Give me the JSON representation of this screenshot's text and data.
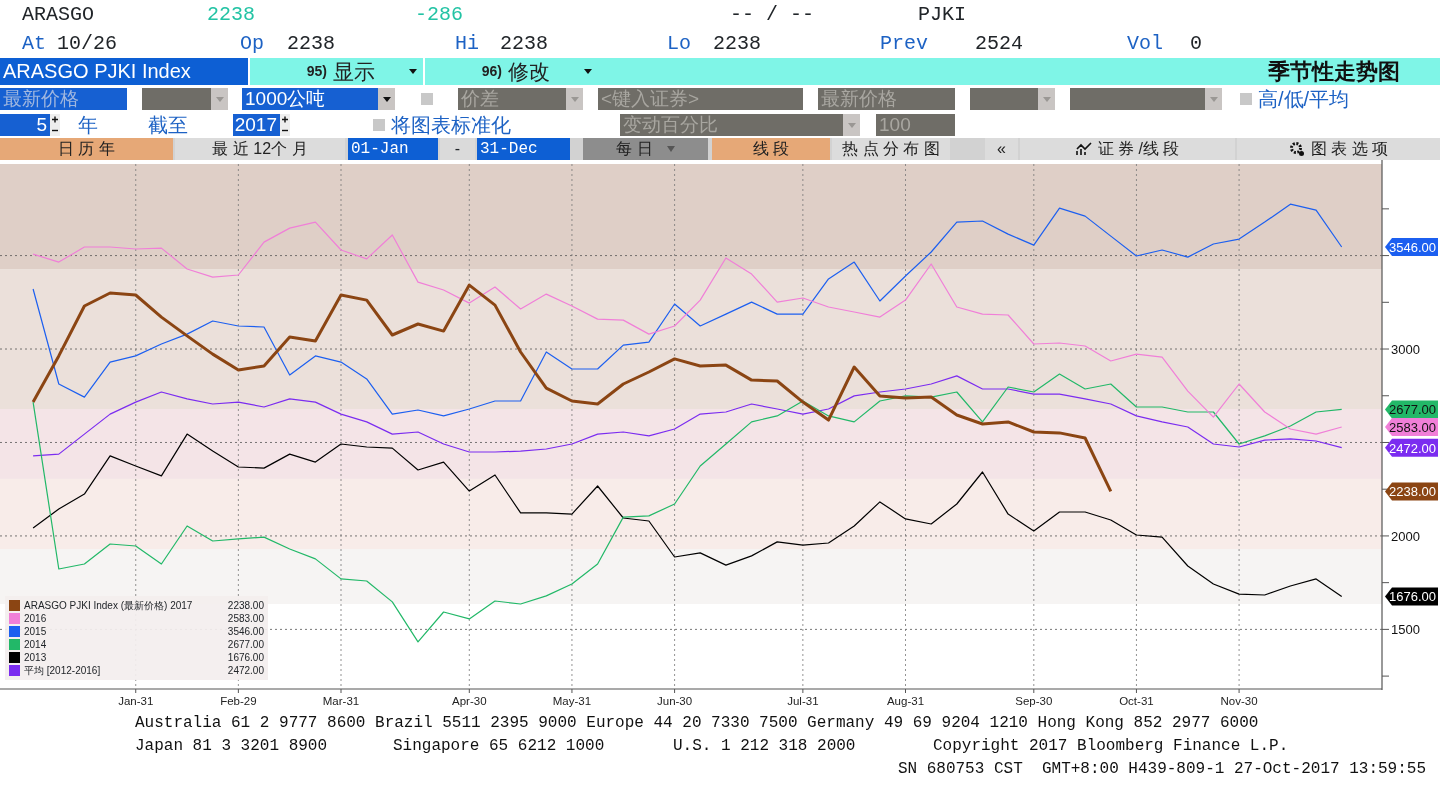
{
  "quote": {
    "ticker": "ARASGO",
    "last": "2238",
    "change": "-286",
    "bid_ask": "-- / --",
    "code": "PJKI"
  },
  "quote_fields": [
    {
      "label": "At",
      "value": "10/26"
    },
    {
      "label": "Op",
      "value": "2238"
    },
    {
      "label": "Hi",
      "value": "2238"
    },
    {
      "label": "Lo",
      "value": "2238"
    },
    {
      "label": "Prev",
      "value": "2524"
    },
    {
      "label": "Vol",
      "value": "0"
    }
  ],
  "title_bar": {
    "security": "ARASGO PJKI Index",
    "menus": [
      {
        "number": "95)",
        "label": "显示"
      },
      {
        "number": "96)",
        "label": "修改"
      }
    ],
    "title": "季节性走势图"
  },
  "settings_row_1": [
    {
      "kind": "field",
      "text": "最新价格",
      "disabled": false
    },
    {
      "kind": "dropdown",
      "disabled": true
    },
    {
      "kind": "dropdown",
      "text": "1000公吨",
      "disabled": false
    },
    {
      "kind": "checkbox",
      "checked": false
    },
    {
      "kind": "dropdown",
      "text": "价差",
      "disabled": true
    },
    {
      "kind": "field",
      "placeholder": "<键入证券>",
      "disabled": true
    },
    {
      "kind": "field",
      "text": "最新价格",
      "disabled": true
    },
    {
      "kind": "dropdown",
      "disabled": true
    },
    {
      "kind": "dropdown",
      "disabled": true
    },
    {
      "kind": "checkbox",
      "checked": false,
      "label": "高/低/平均"
    }
  ],
  "settings_row_2": [
    {
      "kind": "spinner",
      "text": "5"
    },
    {
      "kind": "label",
      "text": "年"
    },
    {
      "kind": "label",
      "text": "截至"
    },
    {
      "kind": "spinner",
      "text": "2017"
    },
    {
      "kind": "checkbox",
      "checked": false,
      "label": "将图表标准化"
    },
    {
      "kind": "dropdown",
      "text": "变动百分比",
      "disabled": true
    },
    {
      "kind": "field",
      "text": "100",
      "disabled": true
    }
  ],
  "toolbar": [
    {
      "kind": "tab",
      "label": "日 历 年",
      "selected": true
    },
    {
      "kind": "tab",
      "label": "最 近 12个 月",
      "selected": false
    },
    {
      "kind": "date",
      "text": "01-Jan"
    },
    {
      "kind": "label",
      "text": "-"
    },
    {
      "kind": "date",
      "text": "31-Dec"
    },
    {
      "kind": "dropdown",
      "text": "每 日",
      "disabled": true
    },
    {
      "kind": "tab",
      "label": "线 段",
      "selected": true
    },
    {
      "kind": "tab",
      "label": "热 点 分 布 图",
      "selected": false
    },
    {
      "kind": "button",
      "label": "«"
    },
    {
      "kind": "series_button",
      "label": "证 券 /线 段"
    },
    {
      "kind": "options_button",
      "label": "图 表 选 项"
    }
  ],
  "chart": {
    "chart_data": {
      "type": "line",
      "categories": [
        null,
        null,
        null,
        null,
        "Jan-31",
        null,
        null,
        null,
        "Feb-29",
        null,
        null,
        null,
        "Mar-31",
        null,
        null,
        null,
        null,
        "Apr-30",
        null,
        null,
        null,
        "May-31",
        null,
        null,
        null,
        "Jun-30",
        null,
        null,
        null,
        null,
        "Jul-31",
        null,
        null,
        null,
        "Aug-31",
        null,
        null,
        null,
        null,
        "Sep-30",
        null,
        null,
        null,
        "Oct-31",
        null,
        null,
        null,
        "Nov-30",
        null,
        null,
        null,
        null
      ],
      "ylim": [
        1181,
        3990
      ],
      "grid": true,
      "legend": "lower left",
      "bands": [
        {
          "axis": "y",
          "from": 3428,
          "to": 3990,
          "color": "#dfcfc7"
        },
        {
          "axis": "y",
          "from": 2679,
          "to": 3428,
          "color": "#ebe0da"
        },
        {
          "axis": "y",
          "from": 2305,
          "to": 2679,
          "color": "#f4e4e7"
        },
        {
          "axis": "y",
          "from": 1930,
          "to": 2305,
          "color": "#f8ece9"
        },
        {
          "axis": "y",
          "from": 1636,
          "to": 1930,
          "color": "#f6f4f3"
        }
      ],
      "yticks": [
        1500,
        2000,
        3000
      ],
      "series": [
        {
          "name": "ARASGO PJKI Index (最新价格) 2017",
          "color": "#8b4513",
          "values": [
            2716,
            2963,
            3230,
            3300,
            3289,
            3171,
            3070,
            2973,
            2888,
            2909,
            3064,
            3043,
            3289,
            3262,
            3075,
            3134,
            3096,
            3342,
            3235,
            2984,
            2791,
            2722,
            2706,
            2813,
            2877,
            2947,
            2909,
            2914,
            2834,
            2829,
            2716,
            2620,
            2904,
            2749,
            2738,
            2743,
            2647,
            2599,
            2610,
            2556,
            2551,
            2524,
            2238,
            null,
            null,
            null,
            null,
            null,
            null,
            null,
            null,
            null
          ]
        },
        {
          "name": "2016",
          "color": "#f07fd8",
          "values": [
            3508,
            3465,
            3546,
            3546,
            3535,
            3540,
            3428,
            3385,
            3396,
            3572,
            3647,
            3679,
            3530,
            3482,
            3610,
            3358,
            3316,
            3246,
            3332,
            3214,
            3294,
            3230,
            3160,
            3155,
            3080,
            3123,
            3262,
            3487,
            3401,
            3251,
            3273,
            3225,
            3198,
            3171,
            3262,
            3455,
            3225,
            3187,
            3182,
            3027,
            3032,
            3016,
            2936,
            2973,
            2957,
            2775,
            2636,
            2813,
            2663,
            2572,
            2545,
            2583
          ]
        },
        {
          "name": "2015",
          "color": "#1c5ff0",
          "values": [
            3321,
            2813,
            2743,
            2930,
            2963,
            3027,
            3080,
            3150,
            3123,
            3118,
            2861,
            2963,
            2930,
            2840,
            2652,
            2674,
            2642,
            2679,
            2722,
            2722,
            2984,
            2893,
            2893,
            3021,
            3037,
            3241,
            3123,
            3187,
            3251,
            3187,
            3187,
            3375,
            3465,
            3257,
            3391,
            3519,
            3679,
            3685,
            3615,
            3556,
            3754,
            3711,
            3604,
            3498,
            3530,
            3492,
            3562,
            3588,
            3679,
            3775,
            3743,
            3546
          ]
        },
        {
          "name": "2014",
          "color": "#22b868",
          "values": [
            2716,
            1823,
            1850,
            1957,
            1946,
            1850,
            2053,
            1973,
            1984,
            1994,
            1930,
            1877,
            1770,
            1759,
            1647,
            1433,
            1593,
            1556,
            1652,
            1636,
            1679,
            1743,
            1850,
            2101,
            2107,
            2171,
            2374,
            2492,
            2610,
            2642,
            2722,
            2642,
            2610,
            2722,
            2749,
            2743,
            2770,
            2610,
            2797,
            2770,
            2866,
            2786,
            2813,
            2690,
            2690,
            2663,
            2663,
            2492,
            2535,
            2588,
            2663,
            2677
          ]
        },
        {
          "name": "2013",
          "color": "#000000",
          "values": [
            2043,
            2144,
            2224,
            2428,
            2374,
            2321,
            2545,
            2454,
            2369,
            2363,
            2438,
            2395,
            2492,
            2476,
            2470,
            2353,
            2395,
            2240,
            2326,
            2123,
            2123,
            2117,
            2267,
            2096,
            2080,
            1887,
            1909,
            1844,
            1893,
            1968,
            1951,
            1962,
            2053,
            2182,
            2091,
            2064,
            2171,
            2342,
            2117,
            2026,
            2128,
            2128,
            2085,
            2005,
            1994,
            1839,
            1743,
            1689,
            1684,
            1732,
            1770,
            1676
          ]
        },
        {
          "name": "平均 [2012-2016]",
          "color": "#7b2cf0",
          "values": [
            2428,
            2438,
            2545,
            2652,
            2716,
            2770,
            2733,
            2706,
            2716,
            2690,
            2733,
            2716,
            2652,
            2610,
            2545,
            2556,
            2492,
            2449,
            2449,
            2454,
            2465,
            2492,
            2545,
            2556,
            2535,
            2572,
            2652,
            2663,
            2706,
            2679,
            2652,
            2679,
            2749,
            2770,
            2786,
            2813,
            2856,
            2786,
            2786,
            2759,
            2759,
            2733,
            2706,
            2642,
            2610,
            2583,
            2492,
            2476,
            2513,
            2519,
            2508,
            2472
          ]
        }
      ]
    },
    "legend": [
      {
        "kind": "current",
        "value": "2238.00"
      },
      {
        "kind": "history",
        "value": "2583.00"
      },
      {
        "kind": "history",
        "value": "3546.00"
      },
      {
        "kind": "history",
        "value": "2677.00"
      },
      {
        "kind": "history",
        "value": "1676.00"
      },
      {
        "kind": "history",
        "value": "2472.00"
      }
    ],
    "price_tags": [
      {
        "text": "3546.00",
        "color": "#1c5ff0"
      },
      {
        "text": "2677.00",
        "color": "#22b868"
      },
      {
        "text": "2583.00",
        "color": "#f07fd8"
      },
      {
        "text": "2472.00",
        "color": "#7b2cf0"
      },
      {
        "text": "2238.00",
        "color": "#8b4513"
      },
      {
        "text": "1676.00",
        "color": "#000000"
      }
    ]
  },
  "footer": {
    "line_1": "Australia 61 2 9777 8600 Brazil 5511 2395 9000 Europe 44 20 7330 7500 Germany 49 69 9204 1210 Hong Kong 852 2977 6000",
    "line_2": [
      "Japan 81 3 3201 8900",
      "Singapore 65 6212 1000",
      "U.S. 1 212 318 2000",
      "Copyright 2017 Bloomberg Finance L.P."
    ],
    "session": "SN 680753 CST  GMT+8:00 H439-809-1 27-Oct-2017 13:59:55"
  }
}
